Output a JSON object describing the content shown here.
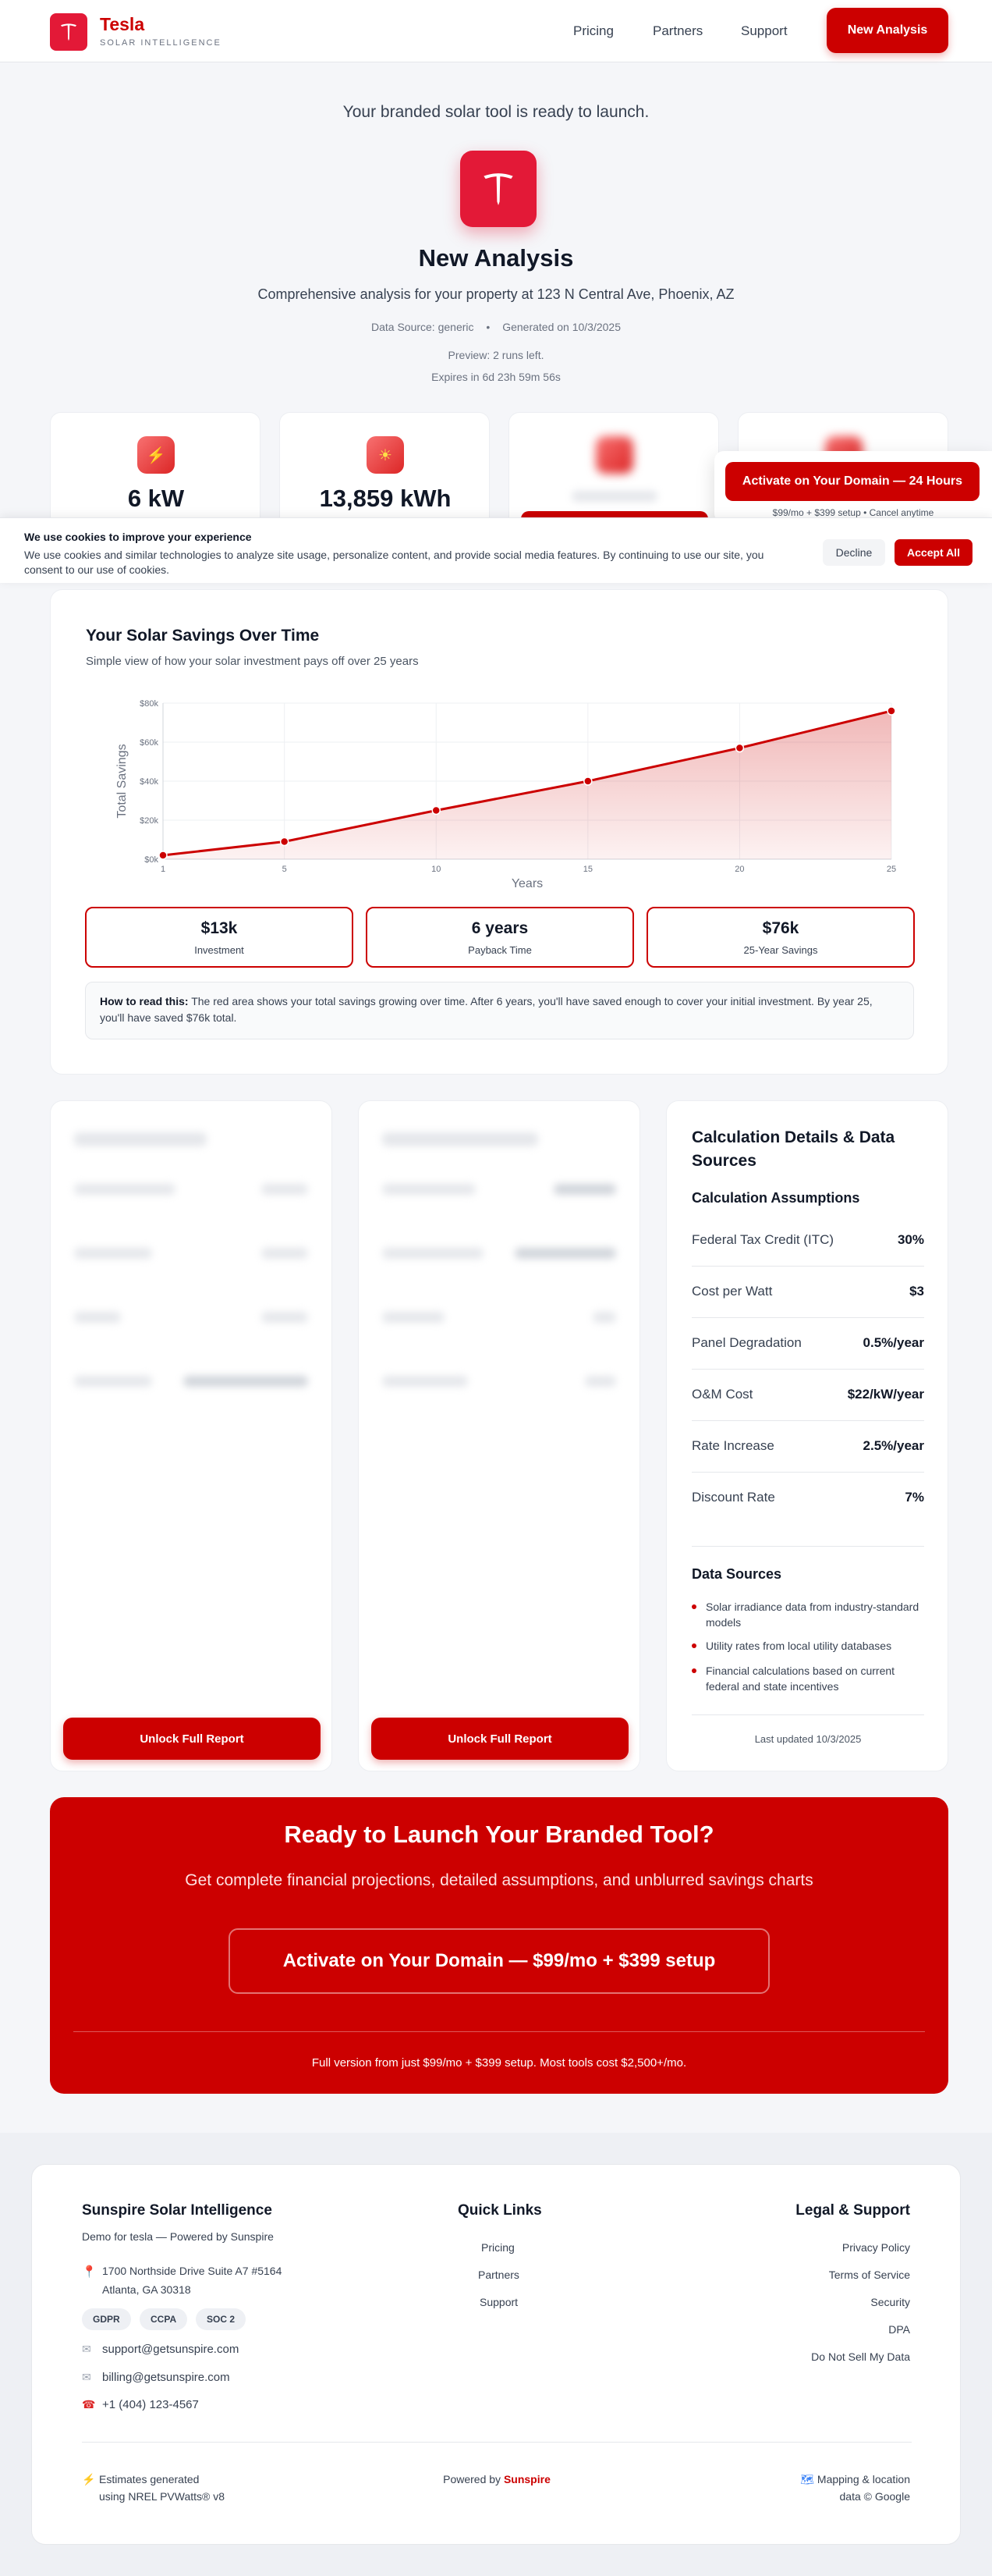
{
  "header": {
    "brand": "Tesla",
    "brand_sub": "SOLAR INTELLIGENCE",
    "nav": [
      "Pricing",
      "Partners",
      "Support"
    ],
    "cta": "New Analysis"
  },
  "hero": {
    "tagline": "Your branded solar tool is ready to launch.",
    "title": "New Analysis",
    "subtitle": "Comprehensive analysis for your property at 123 N Central Ave, Phoenix, AZ",
    "data_source": "Data Source: generic",
    "generated": "Generated on 10/3/2025",
    "preview": "Preview: 2 runs left.",
    "expires": "Expires in 6d 23h 59m 56s"
  },
  "stats": [
    {
      "value": "6 kW",
      "icon": "bolt-icon"
    },
    {
      "value": "13,859 kWh",
      "icon": "sun-icon"
    }
  ],
  "float_cta": {
    "button": "Activate on Your Domain — 24 Hours",
    "sub": "$99/mo + $399 setup • Cancel anytime"
  },
  "cookie": {
    "title": "We use cookies to improve your experience",
    "text": "We use cookies and similar technologies to analyze site usage, personalize content, and provide social media features. By continuing to use our site, you consent to our use of cookies.",
    "decline": "Decline",
    "accept": "Accept All"
  },
  "savings_chart": {
    "title": "Your Solar Savings Over Time",
    "subtitle": "Simple view of how your solar investment pays off over 25 years",
    "summary": [
      {
        "value": "$13k",
        "label": "Investment"
      },
      {
        "value": "6 years",
        "label": "Payback Time"
      },
      {
        "value": "$76k",
        "label": "25-Year Savings"
      }
    ],
    "how_label": "How to read this:",
    "how_text": " The red area shows your total savings growing over time. After 6 years, you'll have saved enough to cover your initial investment. By year 25, you'll have saved $76k total."
  },
  "chart_data": {
    "type": "area",
    "xlabel": "Years",
    "ylabel": "Total Savings",
    "x": [
      1,
      5,
      10,
      15,
      20,
      25
    ],
    "x_ticks": [
      "1",
      "5",
      "10",
      "15",
      "20",
      "25"
    ],
    "y_ticks": [
      "$0k",
      "$20k",
      "$40k",
      "$60k",
      "$80k"
    ],
    "ylim": [
      0,
      80
    ],
    "series": [
      {
        "values": [
          2,
          9,
          25,
          40,
          57,
          76
        ]
      }
    ],
    "grid": true,
    "color": "#cc0000"
  },
  "unlock": {
    "label": "Unlock Full Report"
  },
  "details": {
    "title": "Calculation Details & Data Sources",
    "assumptions_title": "Calculation Assumptions",
    "assumptions": [
      {
        "label": "Federal Tax Credit (ITC)",
        "value": "30%"
      },
      {
        "label": "Cost per Watt",
        "value": "$3"
      },
      {
        "label": "Panel Degradation",
        "value": "0.5%/year"
      },
      {
        "label": "O&M Cost",
        "value": "$22/kW/year"
      },
      {
        "label": "Rate Increase",
        "value": "2.5%/year"
      },
      {
        "label": "Discount Rate",
        "value": "7%"
      }
    ],
    "sources_title": "Data Sources",
    "sources": [
      "Solar irradiance data from industry-standard models",
      "Utility rates from local utility databases",
      "Financial calculations based on current federal and state incentives"
    ],
    "updated": "Last updated 10/3/2025"
  },
  "cta": {
    "title": "Ready to Launch Your Branded Tool?",
    "subtitle": "Get complete financial projections, detailed assumptions, and unblurred savings charts",
    "button": "Activate on Your Domain — $99/mo + $399 setup",
    "footnote": "Full version from just $99/mo + $399 setup. Most tools cost $2,500+/mo."
  },
  "footer": {
    "brand": "Sunspire Solar Intelligence",
    "demo": "Demo for tesla — Powered by Sunspire",
    "address_1": "1700 Northside Drive Suite A7 #5164",
    "address_2": "Atlanta, GA 30318",
    "badges": [
      "GDPR",
      "CCPA",
      "SOC 2"
    ],
    "email_support": "support@getsunspire.com",
    "email_billing": "billing@getsunspire.com",
    "phone": "+1 (404) 123-4567",
    "quick_title": "Quick Links",
    "quick_links": [
      "Pricing",
      "Partners",
      "Support"
    ],
    "legal_title": "Legal & Support",
    "legal_links": [
      "Privacy Policy",
      "Terms of Service",
      "Security",
      "DPA",
      "Do Not Sell My Data"
    ],
    "estimates_1": "Estimates generated",
    "estimates_2": "using NREL PVWatts® v8",
    "powered_by": "Powered by ",
    "powered_brand": "Sunspire",
    "mapping_1": "Mapping & location",
    "mapping_2": "data © Google"
  }
}
